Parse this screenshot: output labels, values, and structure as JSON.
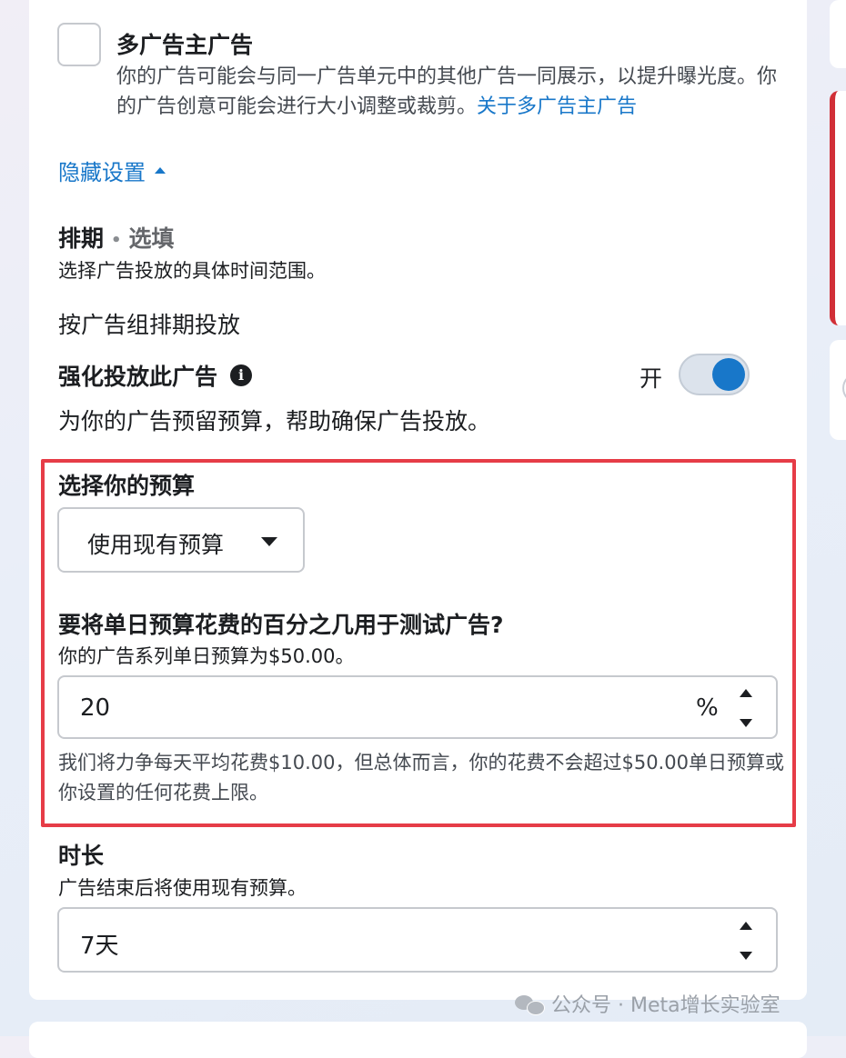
{
  "multi_advertiser": {
    "title": "多广告主广告",
    "description": "你的广告可能会与同一广告单元中的其他广告一同展示，以提升曝光度。你的广告创意可能会进行大小调整或裁剪。",
    "link": "关于多广告主广告",
    "checked": false
  },
  "hide_settings": {
    "label": "隐藏设置"
  },
  "schedule": {
    "title": "排期",
    "separator": "•",
    "optional": "选填",
    "description": "选择广告投放的具体时间范围。",
    "by_ad_group": "按广告组排期投放"
  },
  "boost": {
    "title": "强化投放此广告",
    "info_icon": "info-icon",
    "toggle_label": "开",
    "toggle_on": true,
    "description": "为你的广告预留预算，帮助确保广告投放。"
  },
  "budget": {
    "title": "选择你的预算",
    "selected": "使用现有预算",
    "percent_question": "要将单日预算花费的百分之几用于测试广告?",
    "percent_desc": "你的广告系列单日预算为$50.00。",
    "percent_value": "20",
    "percent_unit": "%",
    "spend_note": "我们将力争每天平均花费$10.00，但总体而言，你的花费不会超过$50.00单日预算或你设置的任何花费上限。"
  },
  "duration": {
    "title": "时长",
    "description": "广告结束后将使用现有预算。",
    "value": "7天"
  },
  "watermark": "公众号 · Meta增长实验室",
  "colors": {
    "link": "#1877c9",
    "toggle": "#1877c9",
    "highlight": "#e63c47",
    "side_accent": "#d12f37"
  }
}
